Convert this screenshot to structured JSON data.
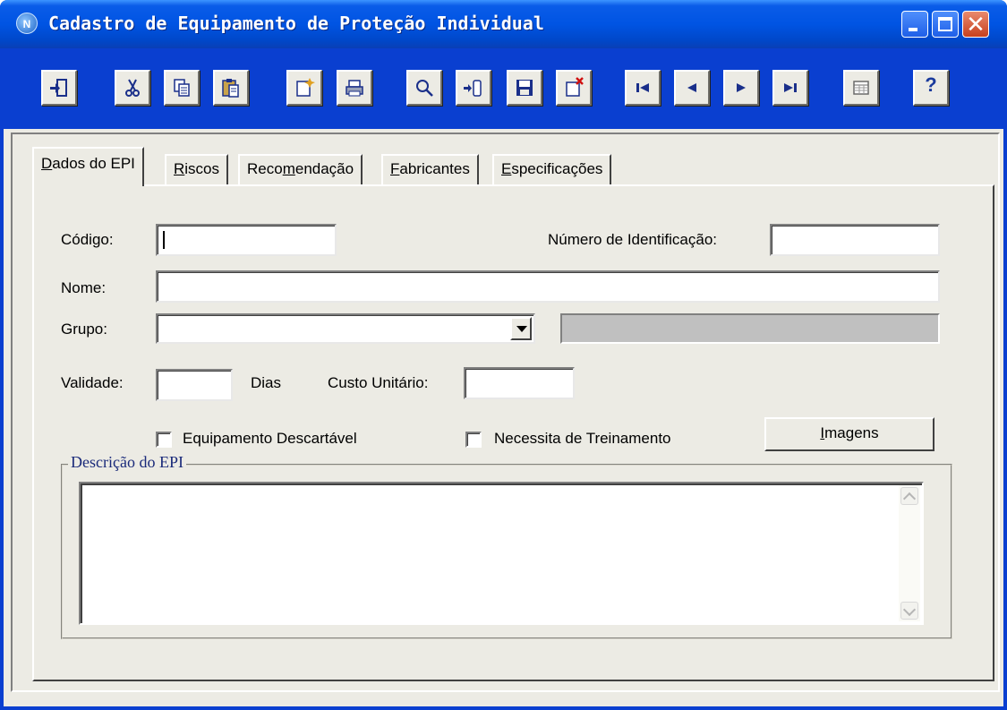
{
  "window": {
    "title": "Cadastro de Equipamento de Proteção Individual",
    "app_icon_glyph": "N"
  },
  "titlebar_buttons": {
    "close_glyph": "✕"
  },
  "toolbar": {
    "help_glyph": "?",
    "icons": [
      "exit-icon",
      "cut-icon",
      "copy-icon",
      "paste-icon",
      "new-record-icon",
      "print-icon",
      "search-icon",
      "insert-icon",
      "save-icon",
      "delete-record-icon",
      "first-record-icon",
      "previous-record-icon",
      "next-record-icon",
      "last-record-icon",
      "grid-view-icon",
      "help-icon"
    ]
  },
  "tabs": [
    {
      "pre": "",
      "u": "D",
      "post": "ados do EPI",
      "active": true
    },
    {
      "pre": "",
      "u": "R",
      "post": "iscos",
      "active": false
    },
    {
      "pre": "Reco",
      "u": "m",
      "post": "endação",
      "active": false
    },
    {
      "pre": "",
      "u": "F",
      "post": "abricantes",
      "active": false
    },
    {
      "pre": "",
      "u": "E",
      "post": "specificações",
      "active": false
    }
  ],
  "form": {
    "codigo_label": "Código:",
    "codigo_value": "",
    "numero_identificacao_label": "Número de Identificação:",
    "numero_identificacao_value": "",
    "nome_label": "Nome:",
    "nome_value": "",
    "grupo_label": "Grupo:",
    "grupo_value": "",
    "grupo_descricao_value": "",
    "validade_label": "Validade:",
    "validade_value": "",
    "dias_label": "Dias",
    "custo_unitario_label": "Custo Unitário:",
    "custo_unitario_value": "",
    "equipamento_descartavel_label": "Equipamento Descartável",
    "equipamento_descartavel_checked": false,
    "necessita_treinamento_label": "Necessita de Treinamento",
    "necessita_treinamento_checked": false,
    "imagens_button_u": "I",
    "imagens_button_rest": "magens",
    "descricao_group_label": "Descrição do EPI",
    "descricao_value": ""
  },
  "colors": {
    "titlebar_blue": "#0054e3",
    "window_border": "#0a3fd0",
    "face": "#ecebe4",
    "disabled_field": "#c0c0c0"
  }
}
